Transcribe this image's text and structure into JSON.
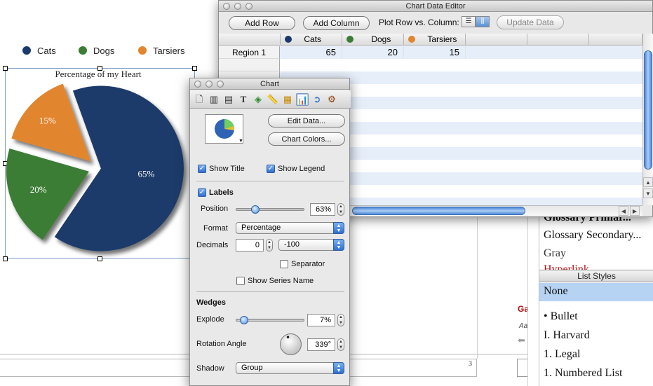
{
  "document": {
    "legend": [
      {
        "label": "Cats",
        "color": "#1b3a6b"
      },
      {
        "label": "Dogs",
        "color": "#3b7d35"
      },
      {
        "label": "Tarsiers",
        "color": "#e1862f"
      }
    ],
    "chart_title": "Percentage of my Heart",
    "page_number": "3"
  },
  "chart_data": {
    "type": "pie",
    "title": "Percentage of my Heart",
    "categories": [
      "Cats",
      "Dogs",
      "Tarsiers"
    ],
    "values": [
      65,
      20,
      15
    ],
    "labels": [
      "65%",
      "20%",
      "15%"
    ],
    "colors": [
      "#1b3a6b",
      "#3b7d35",
      "#e1862f"
    ],
    "legend_position": "top",
    "rotation_angle_deg": 339,
    "explode_pct": 7
  },
  "data_editor": {
    "title": "Chart Data Editor",
    "add_row": "Add Row",
    "add_column": "Add Column",
    "plot_label": "Plot Row vs. Column:",
    "update_data": "Update Data",
    "columns": [
      {
        "label": "Cats",
        "color": "#1b3a6b"
      },
      {
        "label": "Dogs",
        "color": "#3b7d35"
      },
      {
        "label": "Tarsiers",
        "color": "#e1862f"
      }
    ],
    "rows": [
      {
        "label": "Region 1",
        "values": [
          "65",
          "20",
          "15"
        ]
      }
    ]
  },
  "inspector": {
    "title": "Chart",
    "edit_data": "Edit Data...",
    "chart_colors": "Chart Colors...",
    "show_title": "Show Title",
    "show_legend": "Show Legend",
    "labels": "Labels",
    "position_label": "Position",
    "position_value": "63%",
    "position_fraction": 0.25,
    "format_label": "Format",
    "format_value": "Percentage",
    "decimals_label": "Decimals",
    "decimals_value": "0",
    "negative_format": "-100",
    "separator": "Separator",
    "show_series_name": "Show Series Name",
    "wedges": "Wedges",
    "explode_label": "Explode",
    "explode_value": "7%",
    "explode_fraction": 0.07,
    "rotation_label": "Rotation Angle",
    "rotation_value": "339°",
    "shadow_label": "Shadow",
    "shadow_value": "Group"
  },
  "styles_panel": {
    "paragraph_styles": [
      {
        "label": "Glossary Primar...",
        "color": "#111111"
      },
      {
        "label": "Glossary Secondary...",
        "color": "#111111"
      },
      {
        "label": "Gray",
        "color": "#333333"
      },
      {
        "label": "Hyperlink",
        "color": "#b01010"
      }
    ],
    "list_styles_header": "List Styles",
    "list_styles": [
      "None",
      "• Bullet",
      "I. Harvard",
      "1. Legal",
      "1. Numbered List"
    ]
  },
  "doc_fragments": {
    "red_text": "Ga",
    "italic_text": "Aa"
  }
}
